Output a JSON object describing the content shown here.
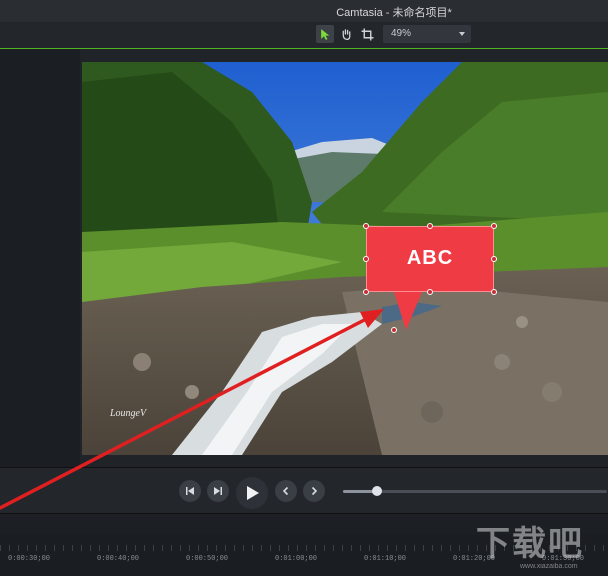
{
  "app": {
    "title": "Camtasia - 未命名项目*"
  },
  "toolbar": {
    "tools": [
      {
        "name": "select-tool",
        "icon": "cursor-arrow-icon",
        "active": true
      },
      {
        "name": "pan-tool",
        "icon": "hand-icon",
        "active": false
      },
      {
        "name": "crop-tool",
        "icon": "crop-icon",
        "active": false
      }
    ],
    "zoom_value": "49%"
  },
  "canvas": {
    "callout_text": "ABC",
    "watermark_text": "LoungeV",
    "callout_color": "#ef3b44"
  },
  "playback": {
    "buttons": [
      "step-back-icon",
      "step-forward-icon",
      "play-icon",
      "previous-marker-icon",
      "next-marker-icon"
    ],
    "volume_level": 0.13
  },
  "timeline": {
    "ruler_labels": [
      "0:00:30;00",
      "0:00:40;00",
      "0:00:50;00",
      "0:01:00;00",
      "0:01:10;00",
      "0:01:20;00",
      "0:01:30;00"
    ]
  },
  "overlay_watermark": {
    "main": "下载吧",
    "sub": "www.xiazaiba.com"
  },
  "colors": {
    "accent": "#50b41e",
    "annotation_arrow": "#e02020"
  }
}
